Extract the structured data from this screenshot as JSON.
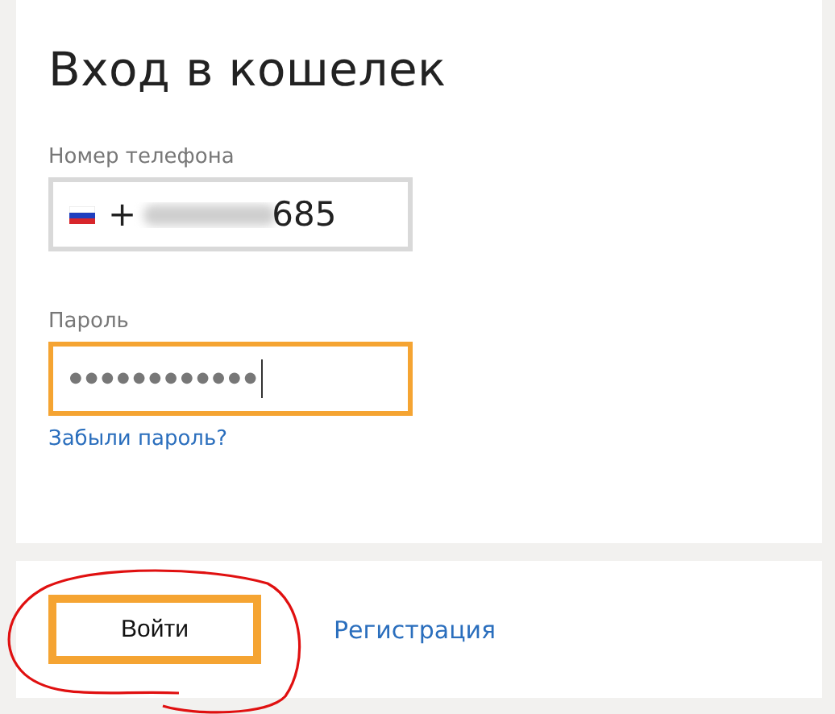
{
  "title": "Вход в кошелек",
  "phone": {
    "label": "Номер телефона",
    "prefix": "+",
    "redacted": true,
    "visible_digits": "685"
  },
  "password": {
    "label": "Пароль",
    "value": "●●●●●●●●●●●●",
    "focused": true
  },
  "forgot_link": "Забыли пароль?",
  "login_button": {
    "label": "Войти",
    "circled": true
  },
  "register_link": "Регистрация"
}
